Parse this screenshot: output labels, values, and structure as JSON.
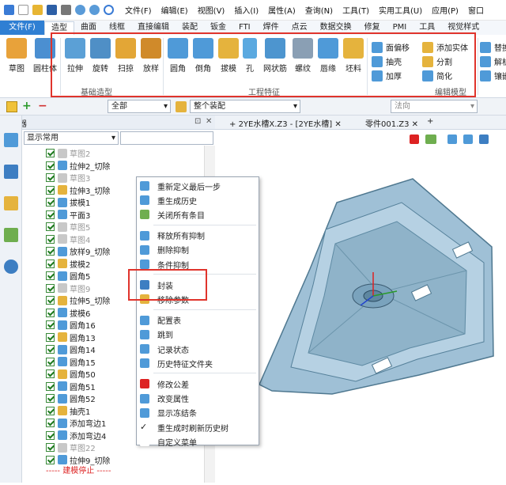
{
  "menubar": {
    "items": [
      "文件(F)",
      "编辑(E)",
      "视图(V)",
      "插入(I)",
      "属性(A)",
      "查询(N)",
      "工具(T)",
      "实用工具(U)",
      "应用(P)",
      "窗口"
    ]
  },
  "ribbon_tabs": [
    "文件(F)",
    "造型",
    "曲面",
    "线框",
    "直接编辑",
    "装配",
    "钣金",
    "FTI",
    "焊件",
    "点云",
    "数据交换",
    "修复",
    "PMI",
    "工具",
    "视觉样式"
  ],
  "ribbon": {
    "basic_group": {
      "label": "基础造型",
      "buttons": [
        "拉伸",
        "旋转",
        "扫掠",
        "放样"
      ]
    },
    "left_buttons": [
      "草图",
      "圆柱体"
    ],
    "feature_group": {
      "label": "工程特征",
      "buttons": [
        "圆角",
        "倒角",
        "拔模",
        "孔",
        "网状筋",
        "螺纹",
        "唇缘",
        "坯料"
      ]
    },
    "edit_group": {
      "label": "编辑模型",
      "items": [
        "面偏移",
        "添加实体",
        "抽壳",
        "分割",
        "加厚",
        "简化"
      ]
    },
    "right_items": [
      "替换",
      "解析",
      "镶嵌"
    ]
  },
  "toolbar2": {
    "filter_value": "全部",
    "assembly_value": "整个装配",
    "direction_placeholder": "法向"
  },
  "manager": {
    "title": "管理器",
    "filter": "显示常用",
    "tree": [
      {
        "label": "草图2",
        "suppressed": true
      },
      {
        "label": "拉伸2_切除",
        "suppressed": false
      },
      {
        "label": "草图3",
        "suppressed": true
      },
      {
        "label": "拉伸3_切除",
        "suppressed": false
      },
      {
        "label": "拔模1",
        "suppressed": false
      },
      {
        "label": "平面3",
        "suppressed": false
      },
      {
        "label": "草图5",
        "suppressed": true
      },
      {
        "label": "草图4",
        "suppressed": true
      },
      {
        "label": "放样9_切除",
        "suppressed": false
      },
      {
        "label": "拔模2",
        "suppressed": false
      },
      {
        "label": "圆角5",
        "suppressed": false
      },
      {
        "label": "草图9",
        "suppressed": true
      },
      {
        "label": "拉伸5_切除",
        "suppressed": false
      },
      {
        "label": "拔模6",
        "suppressed": false
      },
      {
        "label": "圆角16",
        "suppressed": false
      },
      {
        "label": "圆角13",
        "suppressed": false
      },
      {
        "label": "圆角14",
        "suppressed": false
      },
      {
        "label": "圆角15",
        "suppressed": false
      },
      {
        "label": "圆角50",
        "suppressed": false
      },
      {
        "label": "圆角51",
        "suppressed": false
      },
      {
        "label": "圆角52",
        "suppressed": false
      },
      {
        "label": "抽壳1",
        "suppressed": false
      },
      {
        "label": "添加弯边1",
        "suppressed": false
      },
      {
        "label": "添加弯边4",
        "suppressed": false
      },
      {
        "label": "草图22",
        "suppressed": true
      },
      {
        "label": "拉伸9_切除",
        "suppressed": false
      }
    ],
    "stop_marker": "----- 建模停止 -----"
  },
  "doc_tabs": [
    "2YE水槽X.Z3 - [2YE水槽]",
    "零件001.Z3"
  ],
  "context_menu": [
    "重新定义最后一步",
    "重生成历史",
    "关闭所有条目",
    "释放所有抑制",
    "删除抑制",
    "条件抑制",
    "封装",
    "移除参数",
    "配置表",
    "跳到",
    "记录状态",
    "历史特征文件夹",
    "修改公差",
    "改变属性",
    "显示冻结条",
    "重生成时刷新历史树",
    "自定义菜单"
  ],
  "colors": {
    "accent": "#2f7fd3",
    "highlight": "#e0342c",
    "part": "#8fb3c9"
  }
}
